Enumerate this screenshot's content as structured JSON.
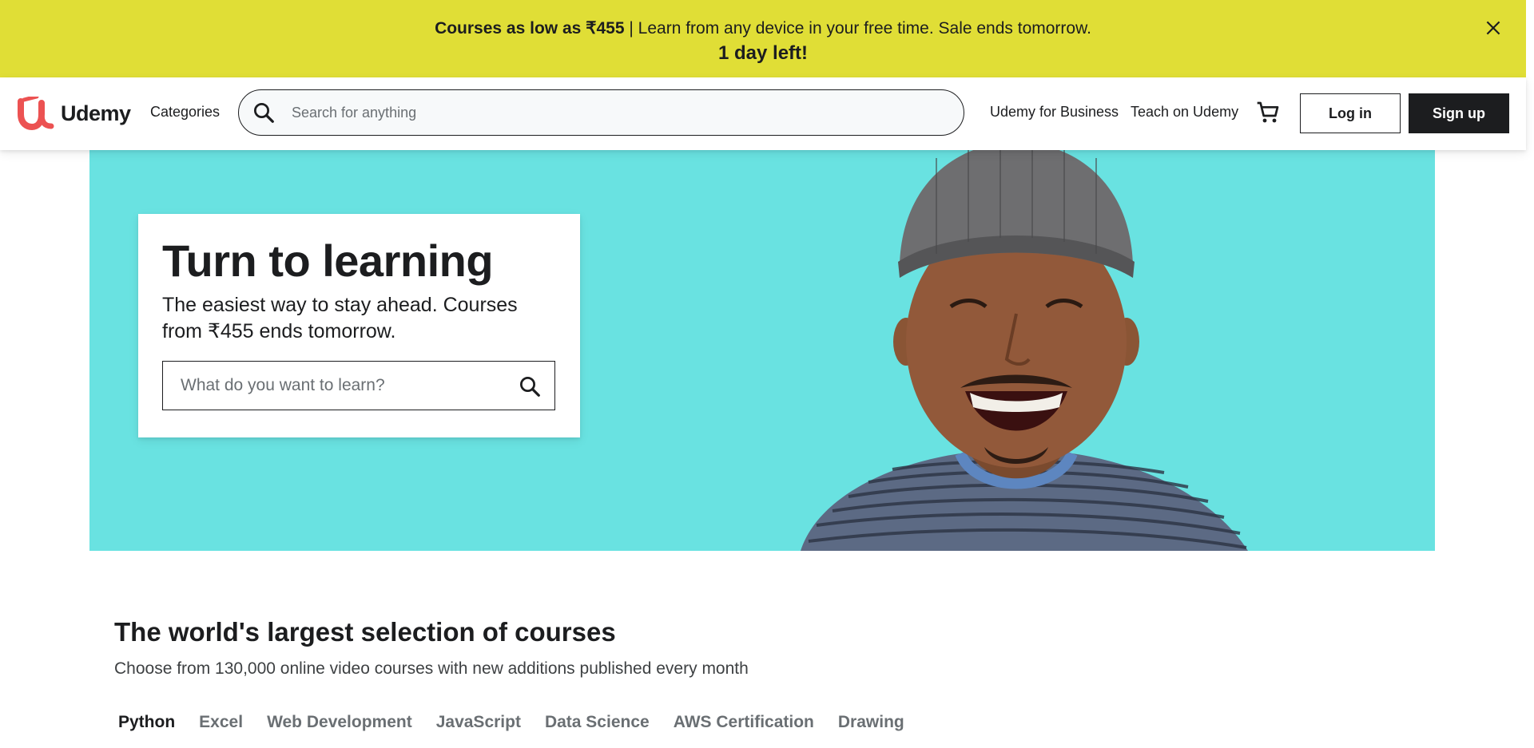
{
  "banner": {
    "bold_text": "Courses as low as ₹455",
    "text": " | Learn from any device in your free time. Sale ends tomorrow.",
    "countdown": "1 day left!",
    "bg_color": "#e0de36"
  },
  "header": {
    "logo_text": "Udemy",
    "categories_label": "Categories",
    "search_placeholder": "Search for anything",
    "business_label": "Udemy for Business",
    "teach_label": "Teach on Udemy",
    "cart_icon": "shopping-cart-icon",
    "login_label": "Log in",
    "signup_label": "Sign up",
    "brand_color": "#ec5252"
  },
  "hero": {
    "title": "Turn to learning",
    "subtitle": "The easiest way to stay ahead. Courses from ₹455 ends tomorrow.",
    "search_placeholder": "What do you want to learn?",
    "bg_color": "#69e2e1"
  },
  "courses": {
    "title": "The world's largest selection of courses",
    "subtitle": "Choose from 130,000 online video courses with new additions published every month",
    "tabs": [
      "Python",
      "Excel",
      "Web Development",
      "JavaScript",
      "Data Science",
      "AWS Certification",
      "Drawing"
    ],
    "active_tab": "Python"
  }
}
